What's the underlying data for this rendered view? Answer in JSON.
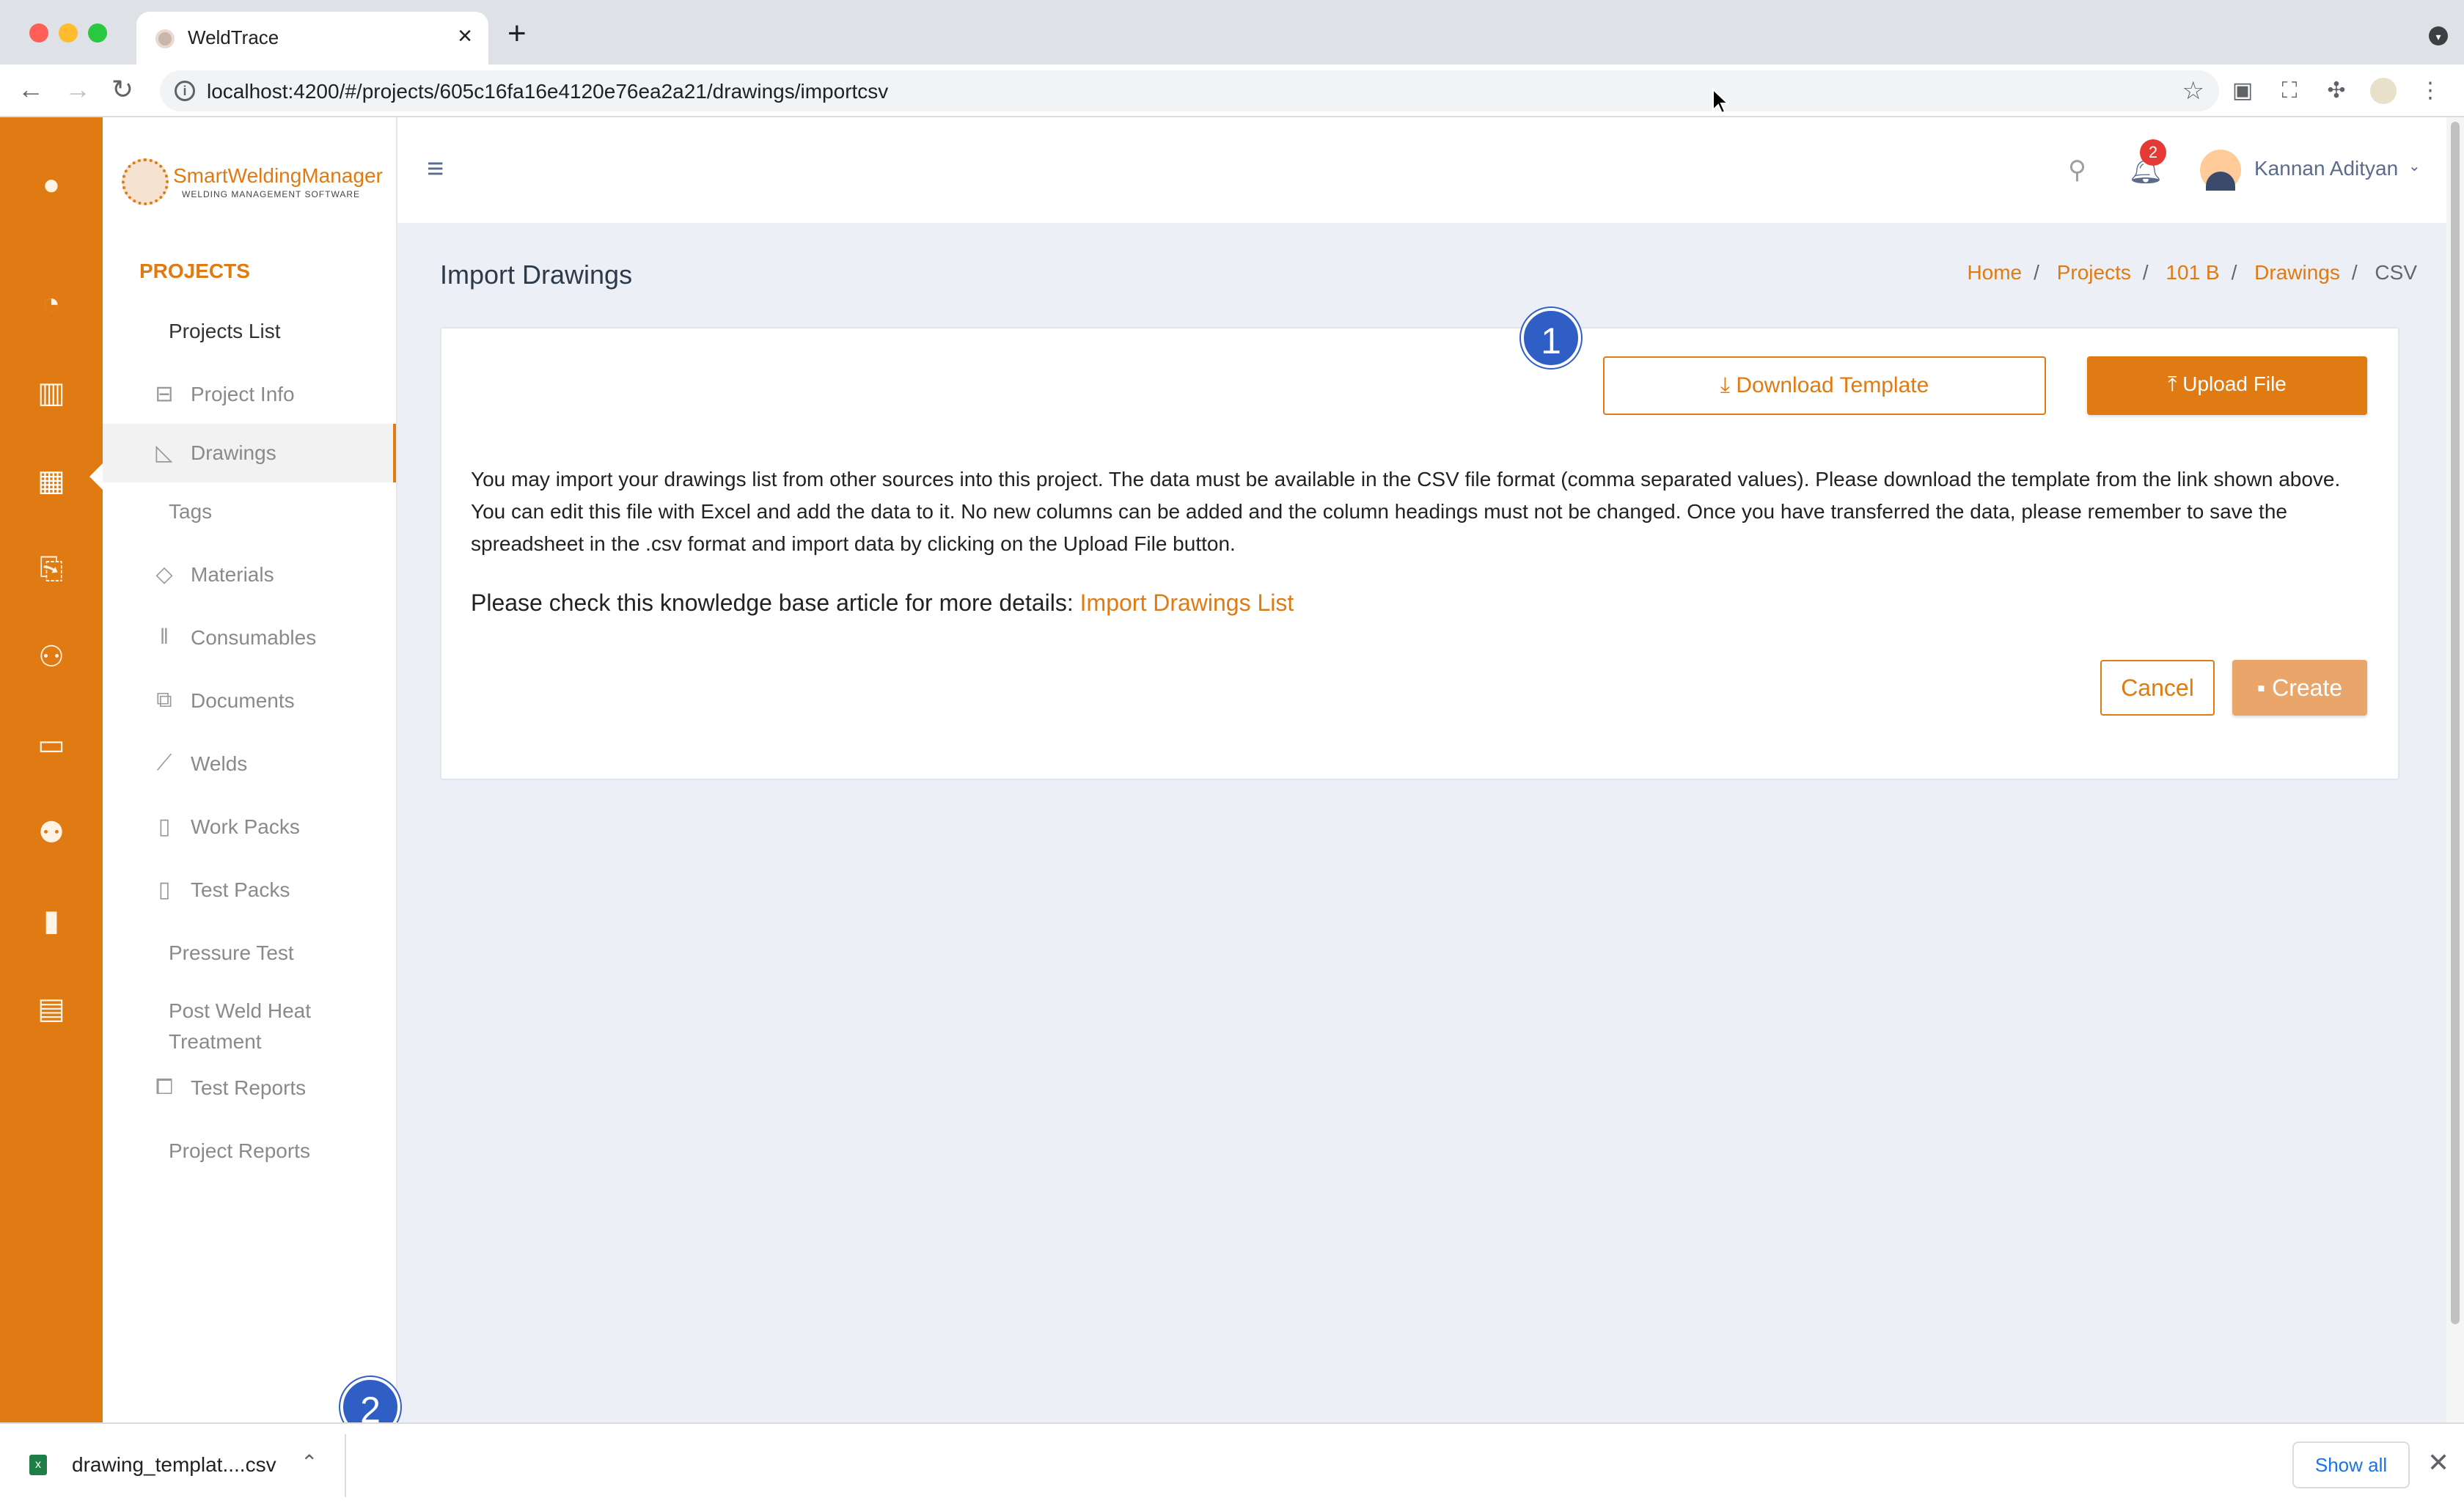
{
  "browser": {
    "tab_title": "WeldTrace",
    "tab_close": "×",
    "new_tab": "+",
    "url": "localhost:4200/#/projects/605c16fa16e4120e76ea2a21/drawings/importcsv",
    "colors": {
      "tabbar": "#dee1e6",
      "red": "#ff5f57",
      "yellow": "#febc2e",
      "green": "#28c840"
    }
  },
  "app": {
    "accent": "#e07a12",
    "logo": {
      "title": "SmartWeldingManager",
      "subtitle": "WELDING MANAGEMENT SOFTWARE"
    },
    "rail_icons": [
      "avatar-icon",
      "pie-chart-icon",
      "building-icon",
      "grid-icon",
      "file-add-icon",
      "user-add-icon",
      "book-icon",
      "users-icon",
      "bar-chart-icon",
      "book-open-icon"
    ],
    "sidebar": {
      "section": "PROJECTS",
      "items": [
        {
          "label": "Projects List",
          "icon": ""
        },
        {
          "label": "Project Info",
          "icon": "briefcase-icon"
        },
        {
          "label": "Drawings",
          "icon": "ruler-icon"
        },
        {
          "label": "Tags",
          "icon": ""
        },
        {
          "label": "Materials",
          "icon": "box-icon"
        },
        {
          "label": "Consumables",
          "icon": "tools-icon"
        },
        {
          "label": "Documents",
          "icon": "documents-icon"
        },
        {
          "label": "Welds",
          "icon": "spark-icon"
        },
        {
          "label": "Work Packs",
          "icon": "clipboard-icon"
        },
        {
          "label": "Test Packs",
          "icon": "clipboard-icon"
        },
        {
          "label": "Pressure Test",
          "icon": ""
        },
        {
          "label": "Post Weld Heat Treatment",
          "icon": ""
        },
        {
          "label": "Test Reports",
          "icon": "report-icon"
        },
        {
          "label": "Project Reports",
          "icon": ""
        }
      ]
    },
    "header": {
      "notification_count": "2",
      "user_name": "Kannan Adityan"
    },
    "page": {
      "title": "Import Drawings",
      "breadcrumb": [
        "Home",
        "Projects",
        "101 B",
        "Drawings"
      ],
      "breadcrumb_current": "CSV",
      "download_template": "Download Template",
      "upload_file": "Upload File",
      "description": "You may import your drawings list from other sources into this project. The data must be available in the CSV file format (comma separated values). Please download the template from the link shown above. You can edit this file with Excel and add the data to it. No new columns can be added and the column headings must not be changed. Once you have transferred the data, please remember to save the spreadsheet in the .csv format and import data by clicking on the Upload File button.",
      "kb_prefix": "Please check this knowledge base article for more details: ",
      "kb_link": "Import Drawings List",
      "cancel": "Cancel",
      "create": "Create"
    },
    "annotations": {
      "step1": "1",
      "step2": "2"
    }
  },
  "downloads": {
    "file_name": "drawing_templat....csv",
    "show_all": "Show all"
  }
}
